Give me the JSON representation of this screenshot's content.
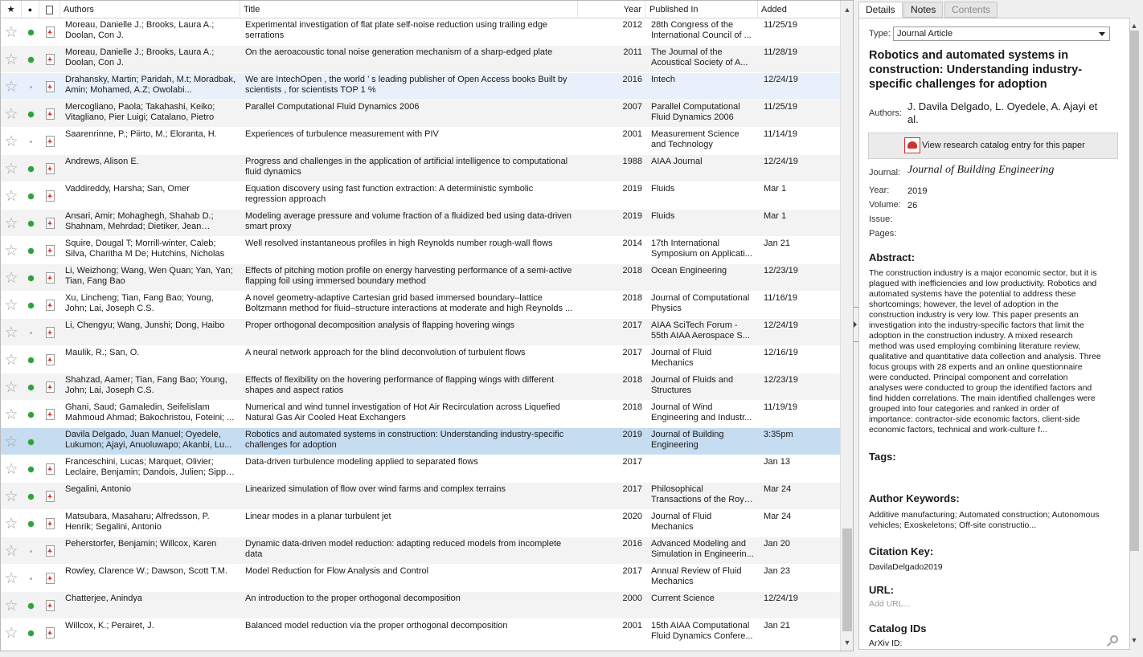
{
  "columns": {
    "star": "★",
    "read": "●",
    "file": "",
    "authors": "Authors",
    "title": "Title",
    "year": "Year",
    "published_in": "Published In",
    "added": "Added"
  },
  "rows": [
    {
      "authors": "Moreau, Danielle J.; Brooks, Laura A.; Doolan, Con J.",
      "title": "Experimental investigation of flat plate self-noise reduction using trailing edge serrations",
      "year": "2012",
      "published_in": "28th Congress of the International Council of ...",
      "added": "11/25/19",
      "read": "green",
      "pdf": true
    },
    {
      "authors": "Moreau, Danielle J.; Brooks, Laura A.; Doolan, Con J.",
      "title": "On the aeroacoustic tonal noise generation mechanism of a sharp-edged plate",
      "year": "2011",
      "published_in": "The Journal of the Acoustical Society of A...",
      "added": "11/28/19",
      "read": "green",
      "pdf": true
    },
    {
      "authors": "Drahansky, Martin; Paridah, M.t; Moradbak, Amin; Mohamed, A.Z; Owolabi...",
      "title": "We are IntechOpen , the world ’ s leading publisher of Open Access books Built by scientists , for scientists TOP 1 %",
      "year": "2016",
      "published_in": "Intech",
      "added": "12/24/19",
      "read": "grey",
      "pdf": true
    },
    {
      "authors": "Mercogliano, Paola; Takahashi, Keiko; Vitagliano, Pier Luigi; Catalano, Pietro",
      "title": "Parallel Computational Fluid Dynamics 2006",
      "year": "2007",
      "published_in": "Parallel Computational Fluid Dynamics 2006",
      "added": "11/25/19",
      "read": "green",
      "pdf": true
    },
    {
      "authors": "Saarenrinne, P.; Piirto, M.; Eloranta, H.",
      "title": "Experiences of turbulence measurement with PIV",
      "year": "2001",
      "published_in": "Measurement Science and Technology",
      "added": "11/14/19",
      "read": "grey",
      "pdf": true
    },
    {
      "authors": "Andrews, Alison E.",
      "title": "Progress and challenges in the application of artificial intelligence to computational fluid dynamics",
      "year": "1988",
      "published_in": "AIAA Journal",
      "added": "12/24/19",
      "read": "green",
      "pdf": true
    },
    {
      "authors": "Vaddireddy, Harsha; San, Omer",
      "title": "Equation discovery using fast function extraction: A deterministic symbolic regression approach",
      "year": "2019",
      "published_in": "Fluids",
      "added": "Mar 1",
      "read": "green",
      "pdf": true
    },
    {
      "authors": "Ansari, Amir; Mohaghegh, Shahab D.; Shahnam, Mehrdad; Dietiker, Jean François",
      "title": "Modeling average pressure and volume fraction of a fluidized bed using data-driven smart proxy",
      "year": "2019",
      "published_in": "Fluids",
      "added": "Mar 1",
      "read": "green",
      "pdf": true
    },
    {
      "authors": "Squire, Dougal T; Morrill-winter, Caleb; Silva, Charitha M De; Hutchins, Nicholas",
      "title": "Well resolved instantaneous profiles in high Reynolds number rough-wall flows",
      "year": "2014",
      "published_in": "17th International Symposium on Applicati...",
      "added": "Jan 21",
      "read": "green",
      "pdf": true
    },
    {
      "authors": "Li, Weizhong; Wang, Wen Quan; Yan, Yan; Tian, Fang Bao",
      "title": "Effects of pitching motion profile on energy harvesting performance of a semi-active flapping foil using immersed boundary method",
      "year": "2018",
      "published_in": "Ocean Engineering",
      "added": "12/23/19",
      "read": "green",
      "pdf": true
    },
    {
      "authors": "Xu, Lincheng; Tian, Fang Bao; Young, John; Lai, Joseph C.S.",
      "title": "A novel geometry-adaptive Cartesian grid based immersed boundary–lattice Boltzmann method for fluid–structure interactions at moderate and high Reynolds ...",
      "year": "2018",
      "published_in": "Journal of Computational Physics",
      "added": "11/16/19",
      "read": "green",
      "pdf": true
    },
    {
      "authors": "Li, Chengyu; Wang, Junshi; Dong, Haibo",
      "title": "Proper orthogonal decomposition analysis of flapping hovering wings",
      "year": "2017",
      "published_in": "AIAA SciTech Forum - 55th AIAA Aerospace S...",
      "added": "12/24/19",
      "read": "grey",
      "pdf": true
    },
    {
      "authors": "Maulik, R.; San, O.",
      "title": "A neural network approach for the blind deconvolution of turbulent flows",
      "year": "2017",
      "published_in": "Journal of Fluid Mechanics",
      "added": "12/16/19",
      "read": "green",
      "pdf": true
    },
    {
      "authors": "Shahzad, Aamer; Tian, Fang Bao; Young, John; Lai, Joseph C.S.",
      "title": "Effects of flexibility on the hovering performance of flapping wings with different shapes and aspect ratios",
      "year": "2018",
      "published_in": "Journal of Fluids and Structures",
      "added": "12/23/19",
      "read": "green",
      "pdf": true
    },
    {
      "authors": "Ghani, Saud; Gamaledin, Seifelislam Mahmoud Ahmad; Bakochristou, Foteini; ...",
      "title": "Numerical and wind tunnel investigation of Hot Air Recirculation across Liquefied Natural Gas Air Cooled Heat Exchangers",
      "year": "2018",
      "published_in": "Journal of Wind Engineering and Industr...",
      "added": "11/19/19",
      "read": "green",
      "pdf": true
    },
    {
      "authors": "Davila Delgado, Juan Manuel; Oyedele, Lukumon; Ajayi, Anuoluwapo; Akanbi, Lu...",
      "title": "Robotics and automated systems in construction: Understanding industry-specific challenges for adoption",
      "year": "2019",
      "published_in": "Journal of Building Engineering",
      "added": "3:35pm",
      "read": "green",
      "pdf": false
    },
    {
      "authors": "Franceschini, Lucas; Marquet, Olivier; Leclaire, Benjamin; Dandois, Julien; Sipp, ...",
      "title": "Data-driven turbulence modeling applied to separated flows",
      "year": "2017",
      "published_in": "",
      "added": "Jan 13",
      "read": "green",
      "pdf": true
    },
    {
      "authors": "Segalini, Antonio",
      "title": "Linearized simulation of flow over wind farms and complex terrains",
      "year": "2017",
      "published_in": "Philosophical Transactions of the Royal Society A: ...",
      "added": "Mar 24",
      "read": "green",
      "pdf": true
    },
    {
      "authors": "Matsubara, Masaharu; Alfredsson, P. Henrik; Segalini, Antonio",
      "title": "Linear modes in a planar turbulent jet",
      "year": "2020",
      "published_in": "Journal of Fluid Mechanics",
      "added": "Mar 24",
      "read": "green",
      "pdf": true
    },
    {
      "authors": "Peherstorfer, Benjamin; Willcox, Karen",
      "title": "Dynamic data-driven model reduction: adapting reduced models from incomplete data",
      "year": "2016",
      "published_in": "Advanced Modeling and Simulation in Engineerin...",
      "added": "Jan 20",
      "read": "grey",
      "pdf": true
    },
    {
      "authors": "Rowley, Clarence W.; Dawson, Scott T.M.",
      "title": "Model Reduction for Flow Analysis and Control",
      "year": "2017",
      "published_in": "Annual Review of Fluid Mechanics",
      "added": "Jan 23",
      "read": "grey",
      "pdf": true
    },
    {
      "authors": "Chatterjee, Anindya",
      "title": "An introduction to the proper orthogonal decomposition",
      "year": "2000",
      "published_in": "Current Science",
      "added": "12/24/19",
      "read": "green",
      "pdf": true
    },
    {
      "authors": "Willcox, K.; Perairet, J.",
      "title": "Balanced model reduction via the proper orthogonal decomposition",
      "year": "2001",
      "published_in": "15th AIAA Computational Fluid Dynamics Confere...",
      "added": "Jan 21",
      "read": "green",
      "pdf": true
    }
  ],
  "highlighted_row": 2,
  "selected_row": 15,
  "tabs": [
    {
      "label": "Details",
      "state": "active"
    },
    {
      "label": "Notes",
      "state": "normal"
    },
    {
      "label": "Contents",
      "state": "disabled"
    }
  ],
  "detail": {
    "type_label": "Type:",
    "type_value": "Journal Article",
    "title": "Robotics and automated systems in construction: Understanding industry-specific challenges for adoption",
    "authors_label": "Authors:",
    "authors_value": "J. Davila Delgado, L. Oyedele, A. Ajayi et al.",
    "catalog_button": "View research catalog entry for this paper",
    "journal_label": "Journal:",
    "journal_value": "Journal of Building Engineering",
    "year_label": "Year:",
    "year_value": "2019",
    "volume_label": "Volume:",
    "volume_value": "26",
    "issue_label": "Issue:",
    "pages_label": "Pages:",
    "abstract_heading": "Abstract:",
    "abstract": "The construction industry is a major economic sector, but it is plagued with inefficiencies and low productivity. Robotics and automated systems have the potential to address these shortcomings; however, the level of adoption in the construction industry is very low. This paper presents an investigation into the industry-specific factors that limit the adoption in the construction industry. A mixed research method was used employing combining literature review, qualitative and quantitative data collection and analysis. Three focus groups with 28 experts and an online questionnaire were conducted. Principal component and correlation analyses were conducted to group the identified factors and find hidden correlations. The main identified challenges were grouped into four categories and ranked in order of importance: contractor-side economic factors, client-side economic factors, technical and work-culture f...",
    "tags_heading": "Tags:",
    "keywords_heading": "Author Keywords:",
    "keywords": "Additive manufacturing; Automated construction; Autonomous vehicles; Exoskeletons; Off-site constructio...",
    "citation_heading": "Citation Key:",
    "citation_key": "DavilaDelgado2019",
    "url_heading": "URL:",
    "url_placeholder": "Add URL...",
    "catalog_heading": "Catalog IDs",
    "arxiv_label": "ArXiv ID:"
  },
  "colors": {
    "selected_row": "#c5dcf1",
    "highlighted_row": "#e8f1fb",
    "read_dot": "#2aa53a",
    "pdf_red": "#d12b2b"
  }
}
